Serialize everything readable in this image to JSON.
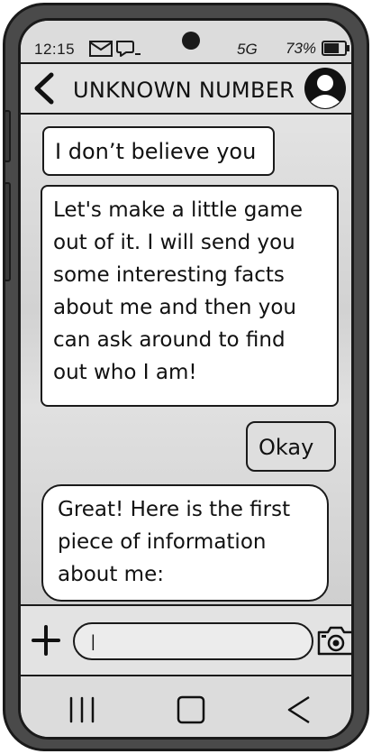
{
  "status_bar": {
    "time": "12:15",
    "network": "5G",
    "battery": "73%",
    "battery_level": 0.73
  },
  "header": {
    "contact_name": "UNKNOWN NUMBER"
  },
  "messages": [
    {
      "direction": "incoming",
      "text": "I don’t believe you"
    },
    {
      "direction": "incoming",
      "lines": [
        "Let's make a little game",
        "out of it. I will send you",
        "some interesting facts",
        "about me and then you",
        "can ask around to find",
        "out who I am!"
      ]
    },
    {
      "direction": "outgoing",
      "text": "Okay"
    },
    {
      "direction": "incoming",
      "lines": [
        "Great! Here is the first",
        "piece of information",
        "about me:"
      ]
    }
  ],
  "composer": {
    "value": "|"
  },
  "icons": {
    "back": "chevron-left-icon",
    "avatar": "user-avatar-icon",
    "plus": "plus-icon",
    "camera": "camera-icon",
    "recents": "recents-icon",
    "home": "home-icon",
    "nav_back": "triangle-back-icon"
  }
}
